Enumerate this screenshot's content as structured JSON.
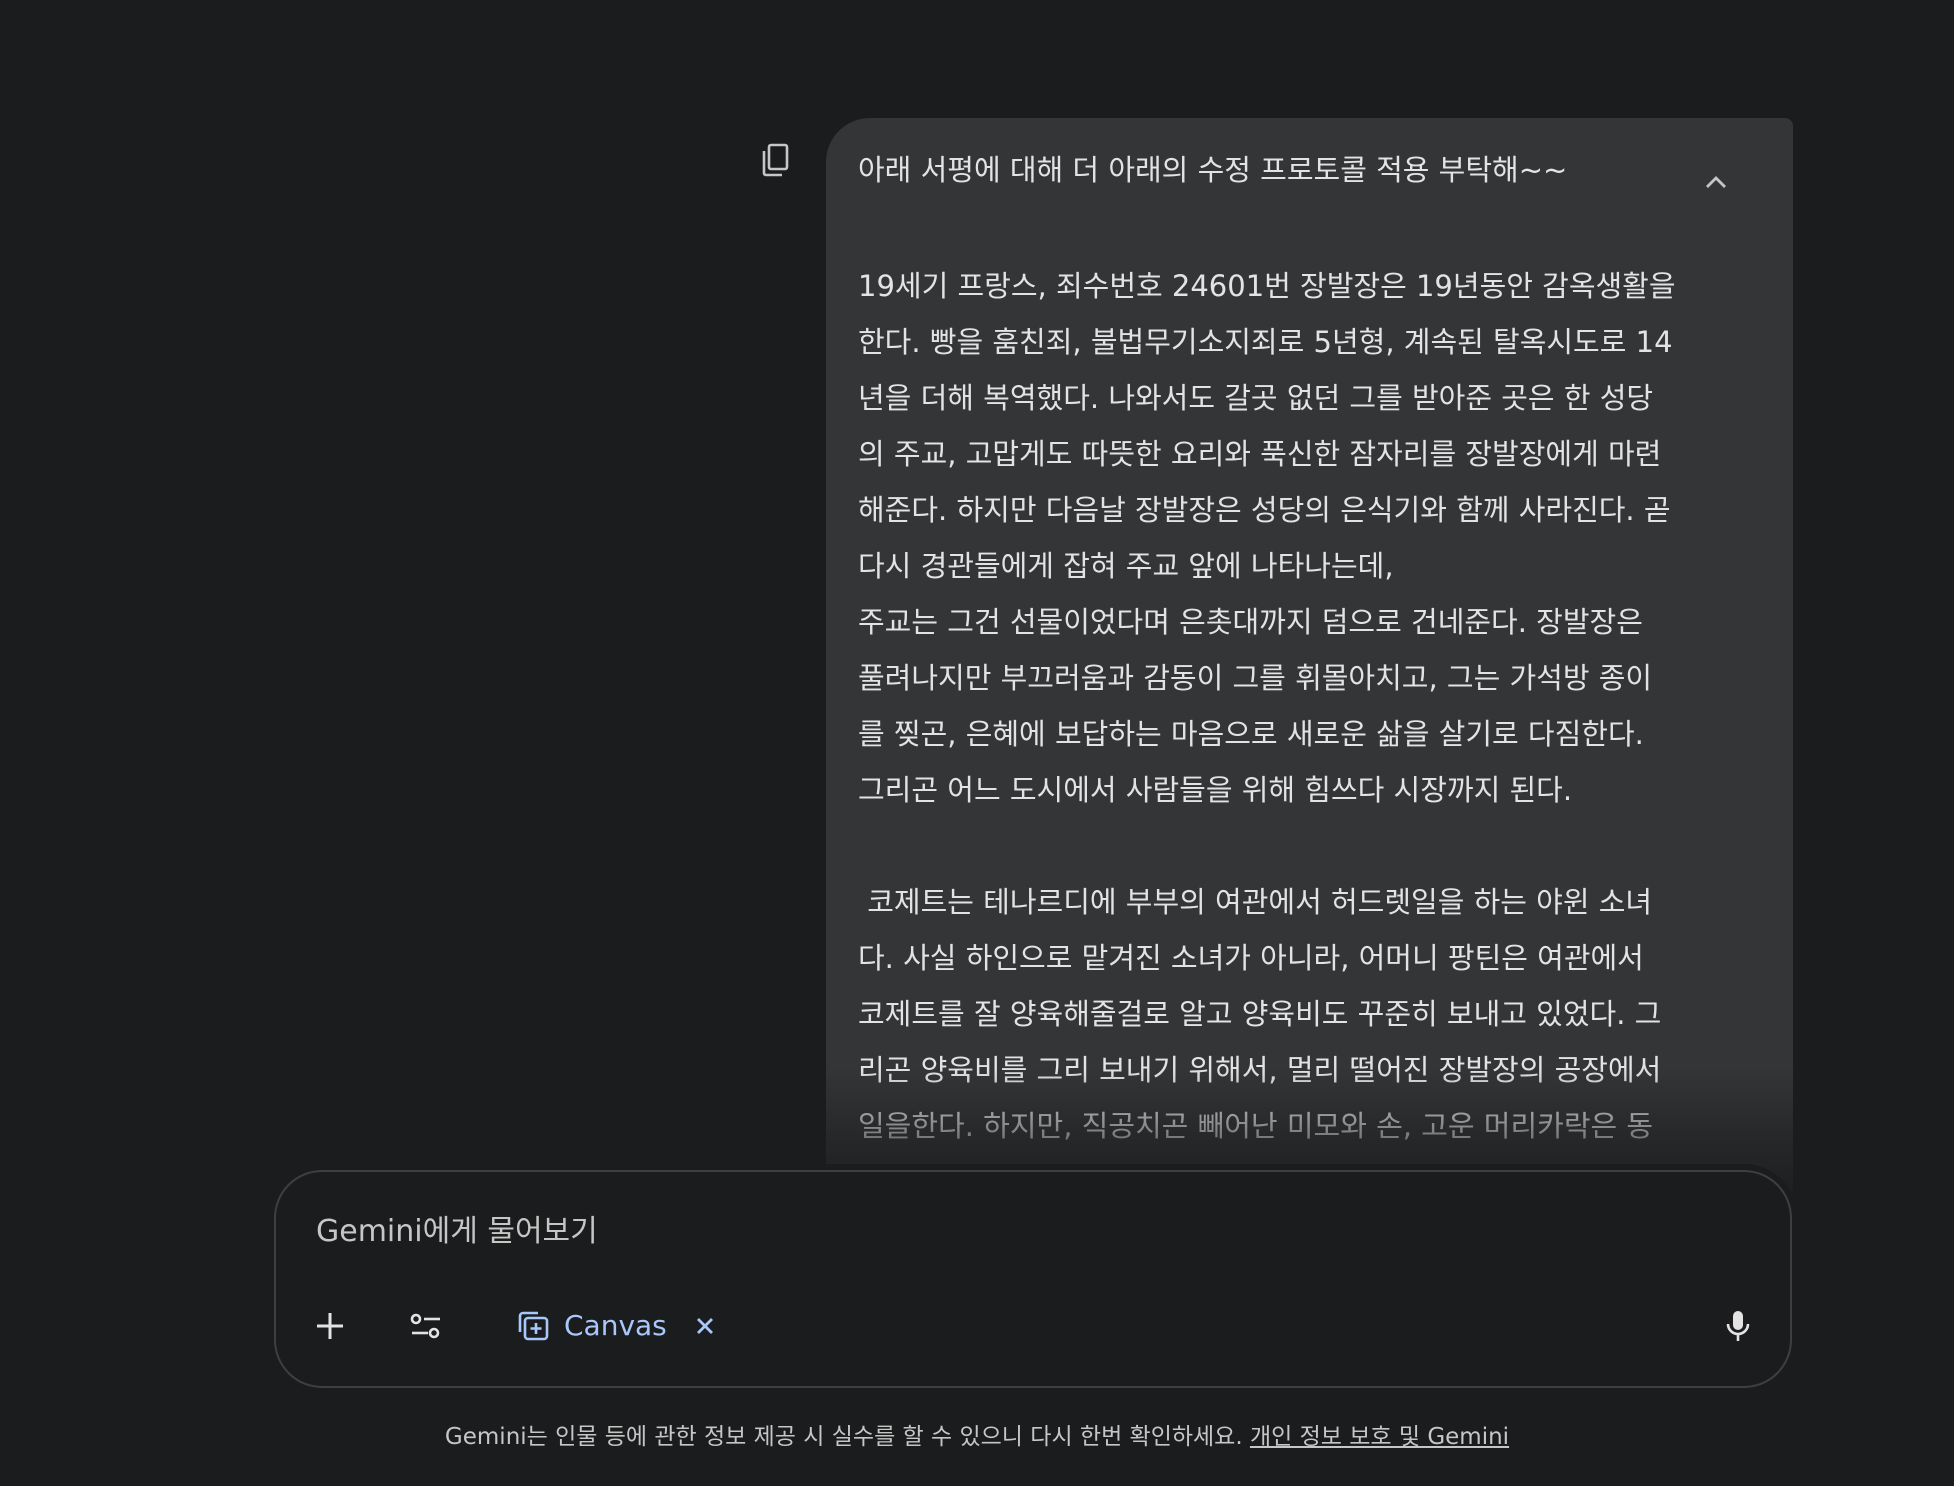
{
  "message": {
    "title": "아래 서평에 대해 더 아래의 수정 프로토콜 적용 부탁해~~",
    "paragraphs": [
      "19세기 프랑스, 죄수번호 24601번 장발장은 19년동안 감옥생활을\n한다. 빵을 훔친죄, 불법무기소지죄로 5년형, 계속된 탈옥시도로 14\n년을 더해 복역했다. 나와서도 갈곳 없던 그를 받아준 곳은 한 성당\n의 주교, 고맙게도 따뜻한 요리와 푹신한 잠자리를 장발장에게 마련\n해준다. 하지만 다음날 장발장은 성당의 은식기와 함께 사라진다. 곧\n다시 경관들에게 잡혀 주교 앞에 나타나는데,\n주교는 그건 선물이었다며 은촛대까지 덤으로 건네준다. 장발장은\n풀려나지만 부끄러움과 감동이 그를 휘몰아치고, 그는 가석방 종이\n를 찢곤, 은혜에 보답하는 마음으로 새로운 삶을 살기로 다짐한다.\n그리곤 어느 도시에서 사람들을 위해 힘쓰다 시장까지 된다.",
      " 코제트는 테나르디에 부부의 여관에서 허드렛일을 하는 야윈 소녀\n다. 사실 하인으로 맡겨진 소녀가 아니라, 어머니 팡틴은 여관에서\n코제트를 잘 양육해줄걸로 알고 양육비도 꾸준히 보내고 있었다. 그\n리곤 양육비를 그리 보내기 위해서, 멀리 떨어진 장발장의 공장에서\n일을한다. 하지만, 직공치곤 빼어난 미모와 손, 고운 머리카락은 동\n료의 질투를 사는 법"
    ]
  },
  "input": {
    "placeholder": "Gemini에게 물어보기",
    "canvas_label": "Canvas"
  },
  "footer": {
    "disclaimer": "Gemini는 인물 등에 관한 정보 제공 시 실수를 할 수 있으니 다시 한번 확인하세요. ",
    "link": "개인 정보 보호 및 Gemini"
  },
  "icons": {
    "copy": "copy-icon",
    "collapse": "chevron-up-icon",
    "add": "plus-icon",
    "tools": "tools-icon",
    "canvas": "canvas-icon",
    "close": "close-icon",
    "mic": "mic-icon"
  },
  "colors": {
    "background": "#1b1c1d",
    "bubble": "#333537",
    "accent": "#a8c7fa",
    "text": "#e3e3e3"
  }
}
